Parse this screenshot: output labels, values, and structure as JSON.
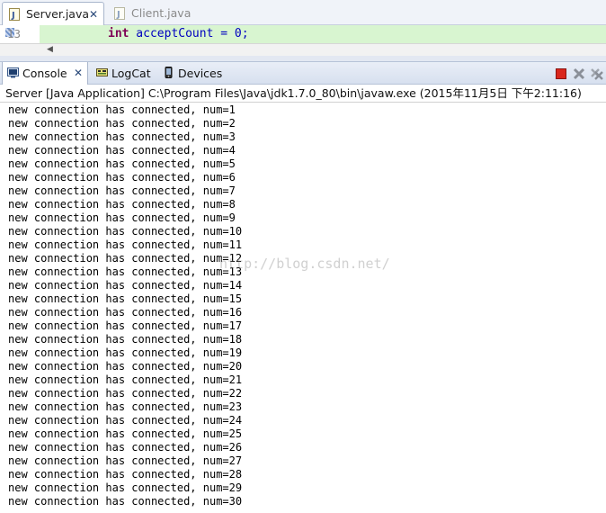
{
  "editor": {
    "tabs": [
      {
        "label": "Server.java",
        "active": true
      },
      {
        "label": "Client.java",
        "active": false
      }
    ],
    "line_number": "13",
    "code_keyword": "int",
    "code_rest": " acceptCount = 0;"
  },
  "console_view": {
    "tabs": [
      {
        "label": "Console",
        "active": true
      },
      {
        "label": "LogCat",
        "active": false
      },
      {
        "label": "Devices",
        "active": false
      }
    ],
    "toolbar_icons": [
      "terminate-icon",
      "remove-launch-icon",
      "remove-all-terminated-icon"
    ],
    "header": "Server [Java Application] C:\\Program Files\\Java\\jdk1.7.0_80\\bin\\javaw.exe (2015年11月5日 下午2:11:16)",
    "lines": [
      "new connection has connected, num=1",
      "new connection has connected, num=2",
      "new connection has connected, num=3",
      "new connection has connected, num=4",
      "new connection has connected, num=5",
      "new connection has connected, num=6",
      "new connection has connected, num=7",
      "new connection has connected, num=8",
      "new connection has connected, num=9",
      "new connection has connected, num=10",
      "new connection has connected, num=11",
      "new connection has connected, num=12",
      "new connection has connected, num=13",
      "new connection has connected, num=14",
      "new connection has connected, num=15",
      "new connection has connected, num=16",
      "new connection has connected, num=17",
      "new connection has connected, num=18",
      "new connection has connected, num=19",
      "new connection has connected, num=20",
      "new connection has connected, num=21",
      "new connection has connected, num=22",
      "new connection has connected, num=23",
      "new connection has connected, num=24",
      "new connection has connected, num=25",
      "new connection has connected, num=26",
      "new connection has connected, num=27",
      "new connection has connected, num=28",
      "new connection has connected, num=29",
      "new connection has connected, num=30"
    ]
  },
  "watermark": "http://blog.csdn.net/",
  "colors": {
    "current_line_highlight": "#d8f5d0",
    "terminate_red": "#d9261c",
    "keyword": "#7f0055"
  }
}
